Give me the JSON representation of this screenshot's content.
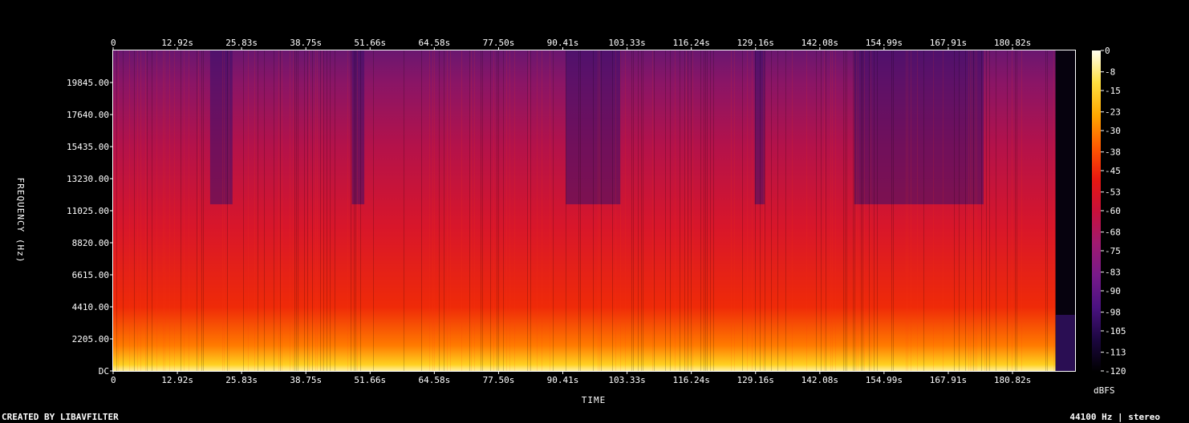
{
  "chart_data": {
    "type": "heatmap",
    "x_ticks": [
      "0",
      "12.92s",
      "25.83s",
      "38.75s",
      "51.66s",
      "64.58s",
      "77.50s",
      "90.41s",
      "103.33s",
      "116.24s",
      "129.16s",
      "142.08s",
      "154.99s",
      "167.91s",
      "180.82s"
    ],
    "x_tick_values": [
      0,
      12.92,
      25.83,
      38.75,
      51.66,
      64.58,
      77.5,
      90.41,
      103.33,
      116.24,
      129.16,
      142.08,
      154.99,
      167.91,
      180.82
    ],
    "xlim": [
      0,
      193.4
    ],
    "xlabel": "TIME",
    "y_ticks": [
      "DC",
      "2205.00",
      "4410.00",
      "6615.00",
      "8820.00",
      "11025.00",
      "13230.00",
      "15435.00",
      "17640.00",
      "19845.00"
    ],
    "y_tick_values": [
      0,
      2205,
      4410,
      6615,
      8820,
      11025,
      13230,
      15435,
      17640,
      19845
    ],
    "ylim": [
      0,
      22050
    ],
    "ylabel": "FREQUENCY (Hz)",
    "colorbar": {
      "ticks": [
        "0",
        "-8",
        "-15",
        "-23",
        "-30",
        "-38",
        "-45",
        "-53",
        "-60",
        "-68",
        "-75",
        "-83",
        "-90",
        "-98",
        "-105",
        "-113",
        "-120"
      ],
      "tick_values": [
        0,
        -8,
        -15,
        -23,
        -30,
        -38,
        -45,
        -53,
        -60,
        -68,
        -75,
        -83,
        -90,
        -98,
        -105,
        -113,
        -120
      ],
      "range": [
        -120,
        0
      ],
      "label": "dBFS",
      "colors": [
        "#000000",
        "#1c0740",
        "#4a1280",
        "#781a8a",
        "#a01a70",
        "#c8103a",
        "#e81810",
        "#ff5a00",
        "#ffa800",
        "#ffe040",
        "#fffff0"
      ]
    },
    "signal_end_s": 189.5
  },
  "footer": {
    "credit": "CREATED BY LIBAVFILTER",
    "info": "44100 Hz | stereo"
  }
}
